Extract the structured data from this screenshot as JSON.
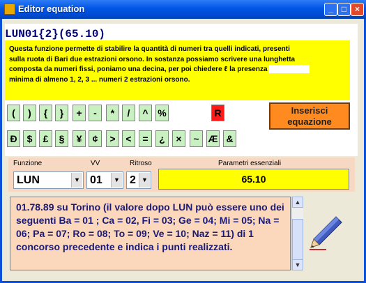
{
  "window": {
    "title": "Editor equation",
    "minimize_glyph": "_",
    "maximize_glyph": "□",
    "close_glyph": "×"
  },
  "formula": "LUN01{2}(65.10)",
  "description": {
    "line1": "Questa funzione permette di stabilire la quantità di numeri tra quelli indicati, presenti",
    "line2": "sulla ruota di Bari due estrazioni orsono. In sostanza possiamo scrivere una lunghetta",
    "line3": "composta da numeri fissi, poniamo una decina, per poi chiedere ℓ la presenza",
    "line4": "minima di almeno 1, 2, 3 ... numeri 2 estrazioni orsono."
  },
  "symbols_row1": [
    "(",
    ")",
    "{",
    "}",
    "+",
    "-",
    "*",
    "/",
    "^",
    "%",
    "R"
  ],
  "symbols_row2": [
    "Ð",
    "$",
    "£",
    "§",
    "¥",
    "¢",
    ">",
    "<",
    "=",
    "¿",
    "×",
    "~",
    "Æ",
    "&"
  ],
  "insert_button": {
    "line1": "Inserisci",
    "line2": "equazione"
  },
  "fields": {
    "funzione_label": "Funzione",
    "vv_label": "VV",
    "ritroso_label": "Ritroso",
    "parametri_label": "Parametri essenziali",
    "funzione_value": "LUN",
    "vv_value": "01",
    "ritroso_value": "2",
    "parametri_value": "65.10"
  },
  "info_text": "01.78.89 su Torino (il valore dopo LUN può essere uno dei seguenti  Ba = 01 ; Ca = 02, Fi = 03; Ge = 04; Mi = 05; Na = 06; Pa = 07; Ro = 08; To = 09; Ve = 10; Naz = 11) di 1 concorso precedente e indica i punti realizzati.",
  "colors": {
    "titlebar": "#0055e5",
    "desc_bg": "#ffff00",
    "symbol_bg": "#c8f0c0",
    "insert_bg": "#ff8a1f",
    "info_bg": "#fbd7bc"
  }
}
